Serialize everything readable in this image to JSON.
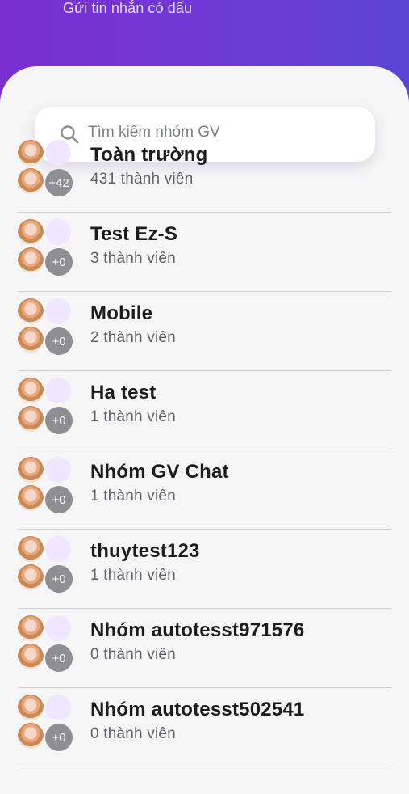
{
  "header": {
    "subtitle": "Gửi tin nhắn có dấu"
  },
  "search": {
    "placeholder": "Tìm kiếm nhóm GV",
    "icon": "search-icon"
  },
  "groups": [
    {
      "name": "Toàn trường",
      "members": "431 thành viên",
      "more": "+42"
    },
    {
      "name": "Test Ez-S",
      "members": "3 thành viên",
      "more": "+0"
    },
    {
      "name": "Mobile",
      "members": "2 thành viên",
      "more": "+0"
    },
    {
      "name": "Ha test",
      "members": "1 thành viên",
      "more": "+0"
    },
    {
      "name": "Nhóm GV Chat",
      "members": "1 thành viên",
      "more": "+0"
    },
    {
      "name": "thuytest123",
      "members": "1 thành viên",
      "more": "+0"
    },
    {
      "name": "Nhóm autotesst971576",
      "members": "0 thành viên",
      "more": "+0"
    },
    {
      "name": "Nhóm autotesst502541",
      "members": "0 thành viên",
      "more": "+0"
    }
  ],
  "colors": {
    "header_gradient_start": "#7a2fd0",
    "header_gradient_end": "#5b45d6",
    "count_badge": "#8f8f93",
    "background": "#f5f5f6"
  }
}
